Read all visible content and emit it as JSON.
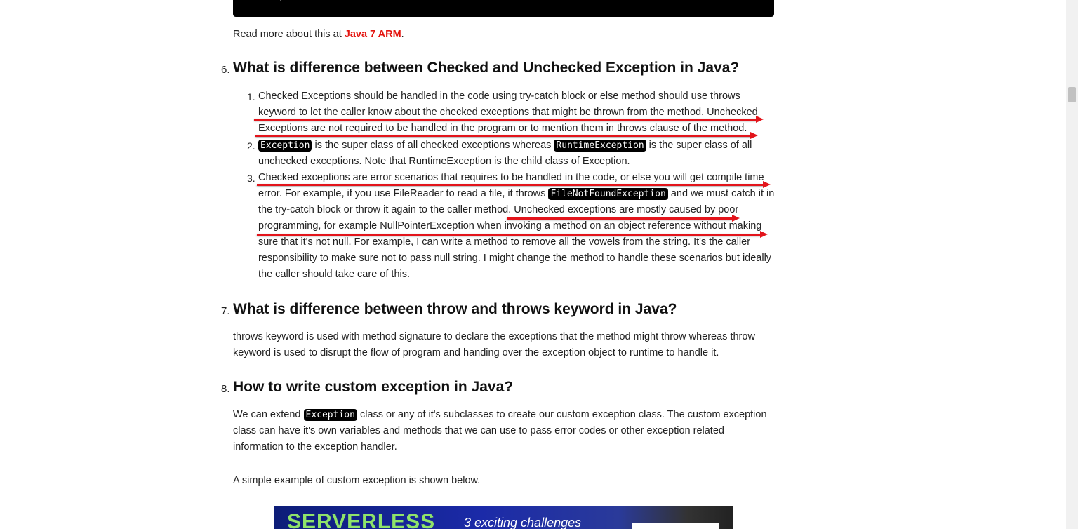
{
  "code_tail": "}",
  "intro": {
    "text": "Read more about this at ",
    "link": "Java 7 ARM",
    "end": "."
  },
  "sections": [
    {
      "num": "6.",
      "title": "What is difference between Checked and Unchecked Exception in Java?",
      "items": [
        {
          "num": "1.",
          "text": "Checked Exceptions should be handled in the code using try-catch block or else method should use throws keyword to let the caller know about the checked exceptions that might be thrown from the method. Unchecked Exceptions are not required to be handled in the program or to mention them in throws clause of the method."
        },
        {
          "num": "2.",
          "code1": "Exception",
          "t1": " is the super class of all checked exceptions whereas ",
          "code2": "RuntimeException",
          "t2": " is the super class of all unchecked exceptions. Note that RuntimeException is the child class of Exception."
        },
        {
          "num": "3.",
          "t1": "Checked exceptions are error scenarios that requires to be handled in the code, or else you will get compile time error. For example, if you use FileReader to read a file, it throws ",
          "code1": "FileNotFoundException",
          "t2": " and we must catch it in the try-catch block or throw it again to the caller method. Unchecked exceptions are mostly caused by poor programming, for example NullPointerException when invoking a method on an object reference without making sure that it's not null. For example, I can write a method to remove all the vowels from the string. It's the caller responsibility to make sure not to pass null string. I might change the method to handle these scenarios but ideally the caller should take care of this."
        }
      ]
    },
    {
      "num": "7.",
      "title": "What is difference between throw and throws keyword in Java?",
      "para": "throws keyword is used with method signature to declare the exceptions that the method might throw whereas throw keyword is used to disrupt the flow of program and handing over the exception object to runtime to handle it."
    },
    {
      "num": "8.",
      "title": "How to write custom exception in Java?",
      "p1_a": "We can extend ",
      "p1_code": "Exception",
      "p1_b": " class or any of it's subclasses to create our custom exception class. The custom exception class can have it's own variables and methods that we can use to pass error codes or other exception related information to the exception handler.",
      "p2": "A simple example of custom exception is shown below."
    }
  ],
  "ad": {
    "brand": "SERVERLESS",
    "tagline": "3 exciting challenges"
  },
  "colors": {
    "link": "#e4140f",
    "annotation_arrow": "#e3141b",
    "code_bg": "#000000"
  }
}
